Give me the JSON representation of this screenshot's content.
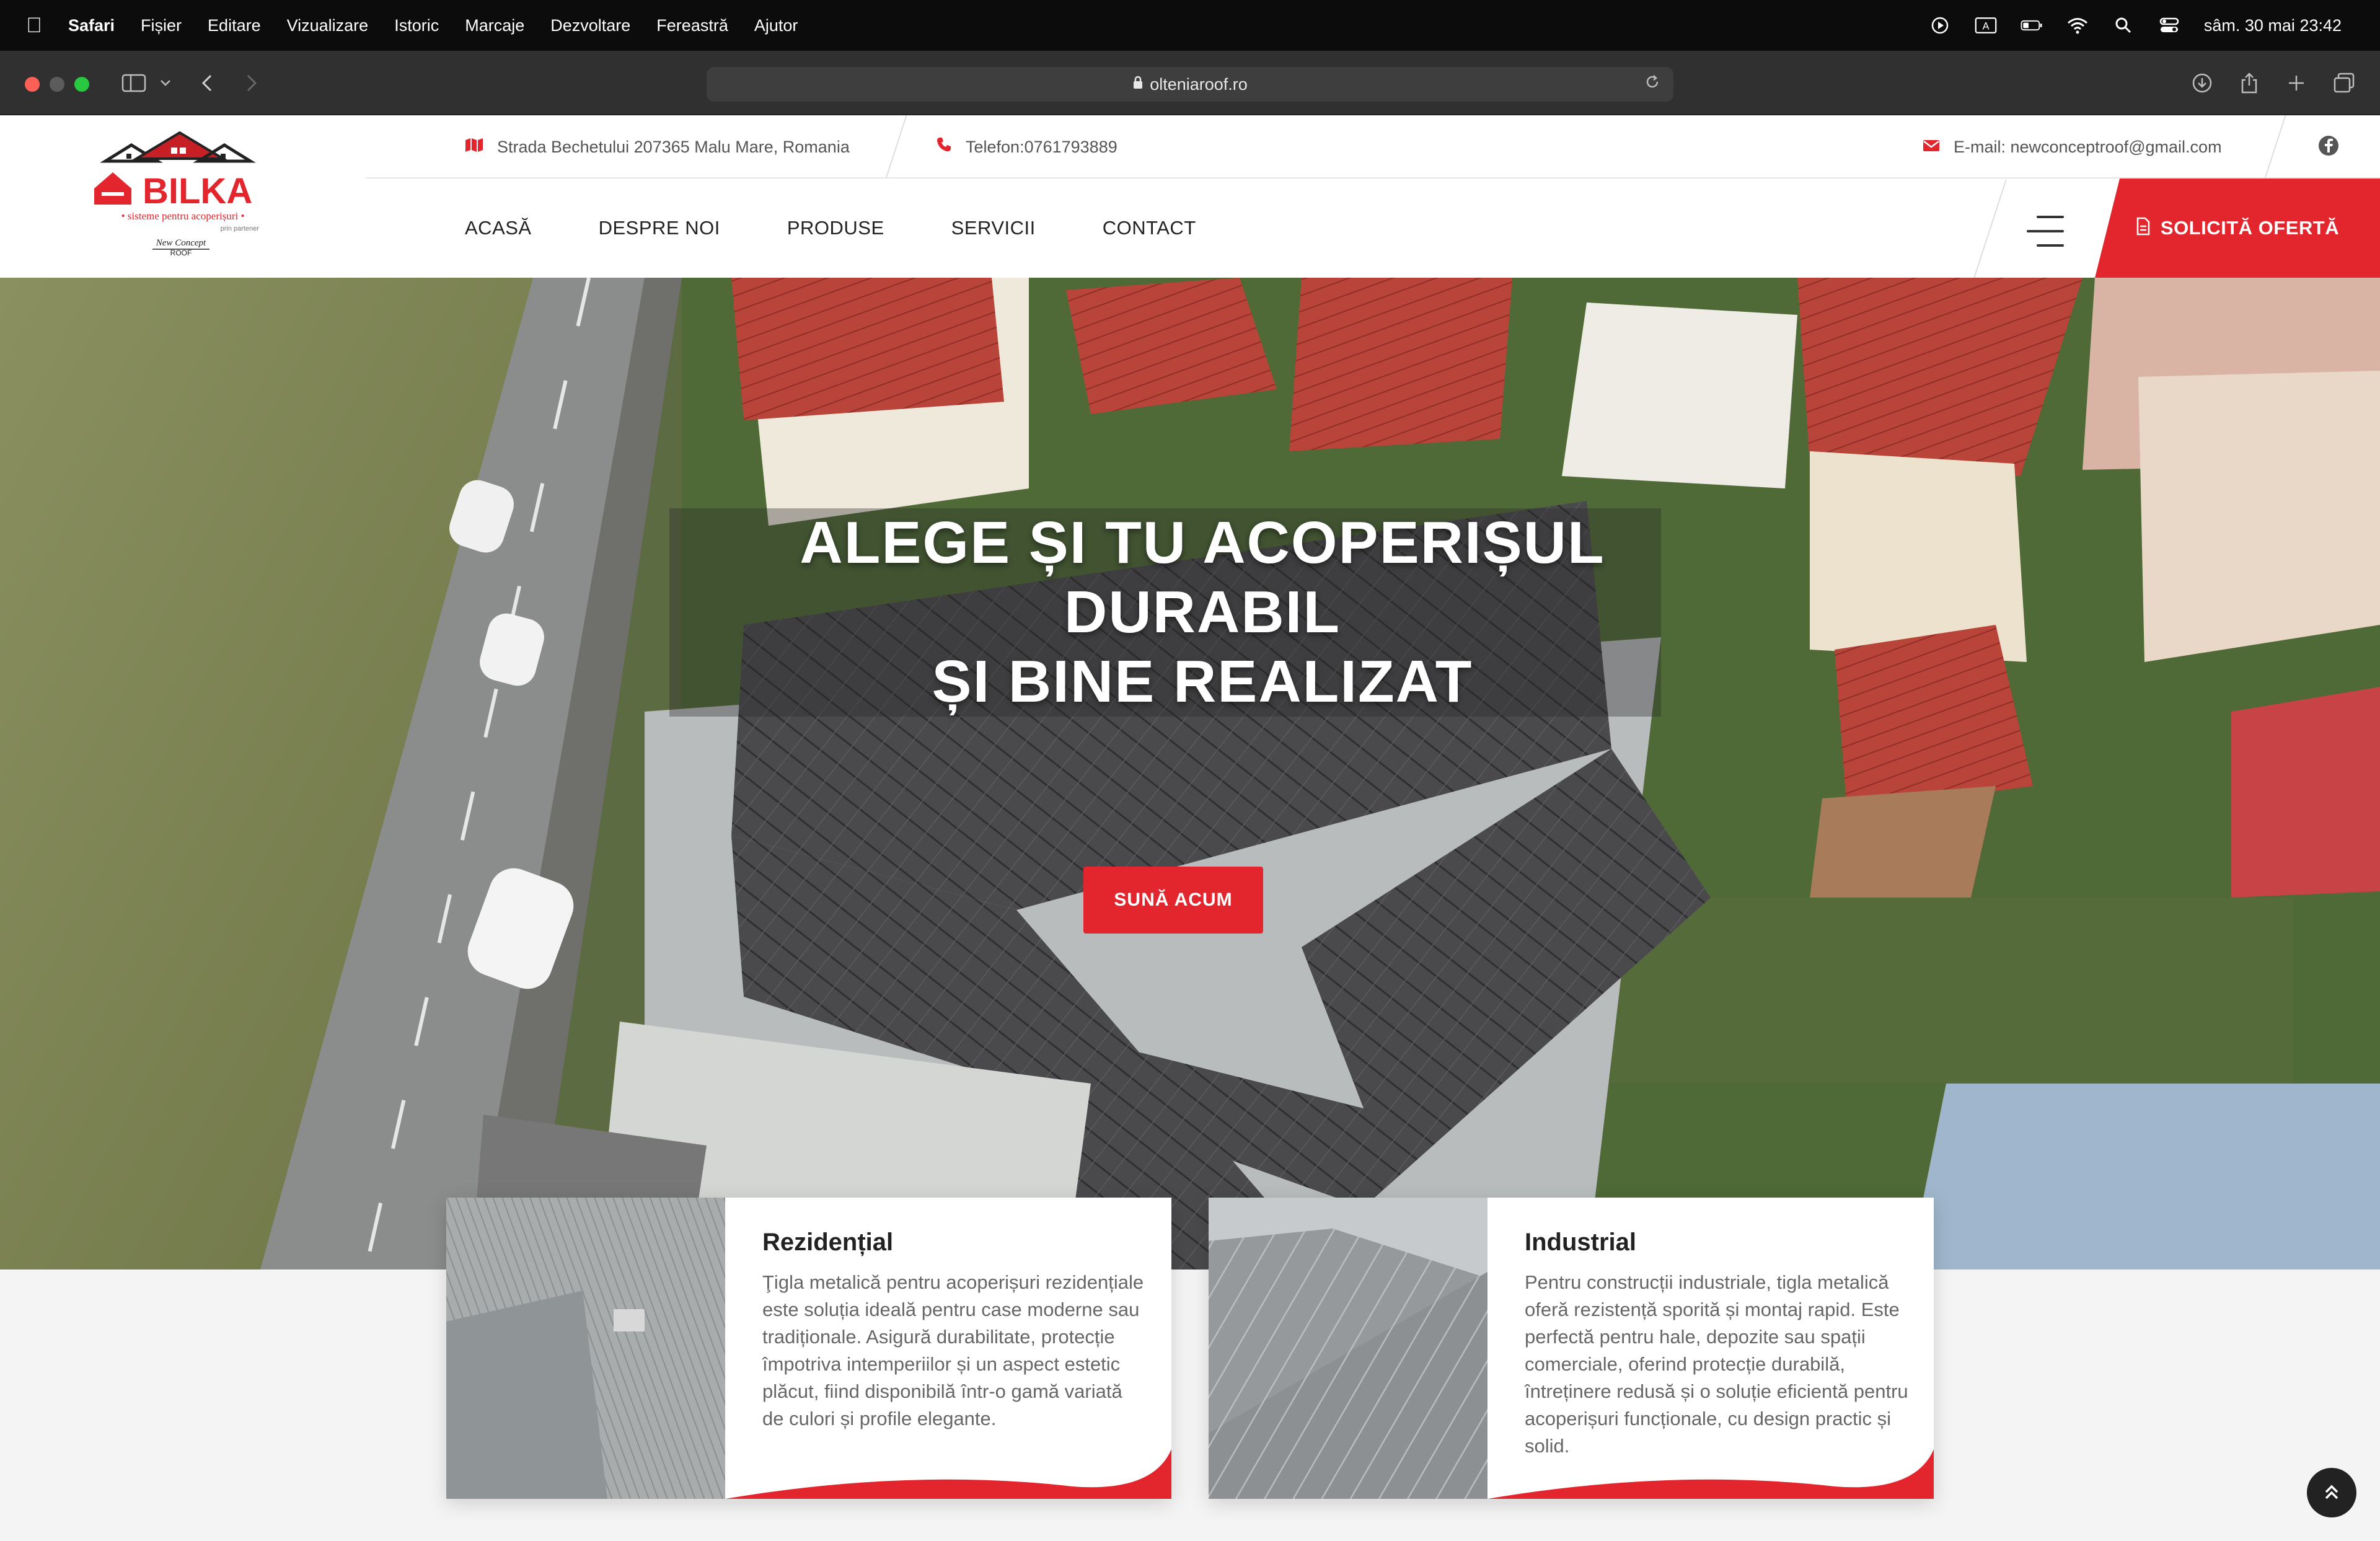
{
  "menubar": {
    "app": "Safari",
    "items": [
      "Fișier",
      "Editare",
      "Vizualizare",
      "Istoric",
      "Marcaje",
      "Dezvoltare",
      "Fereastră",
      "Ajutor"
    ],
    "keyboard_indicator": "A",
    "clock": "sâm. 30 mai  23:42"
  },
  "browser": {
    "url": "olteniaroof.ro"
  },
  "logo": {
    "brand": "BILKA",
    "tagline": "• sisteme pentru acoperișuri •",
    "partner_note": "prin partener",
    "partner_name": "New Concept ROOF"
  },
  "topinfo": {
    "address": "Strada Bechetului 207365 Malu Mare, Romania",
    "phone": "Telefon:0761793889",
    "email": "E-mail:  newconceptroof@gmail.com"
  },
  "nav": {
    "items": [
      "ACASĂ",
      "DESPRE NOI",
      "PRODUSE",
      "SERVICII",
      "CONTACT"
    ],
    "cta": "SOLICITĂ OFERTĂ"
  },
  "hero": {
    "line1": "ALEGE ȘI TU ACOPERIȘUL",
    "line2": "DURABIL",
    "line3": "ȘI BINE REALIZAT",
    "button": "SUNĂ ACUM"
  },
  "cards": [
    {
      "title": "Rezidențial",
      "text": "Ţigla metalică pentru acoperișuri rezidențiale este soluția ideală pentru case moderne sau tradiționale. Asigură durabilitate, protecție împotriva intemperiilor și un aspect estetic plăcut, fiind disponibilă într-o gamă variată de culori și profile elegante."
    },
    {
      "title": "Industrial",
      "text": "Pentru construcții industriale, tigla metalică oferă rezistență sporită și montaj rapid. Este perfectă pentru hale, depozite sau spații comerciale, oferind protecție durabilă, întreținere redusă și o soluție eficientă pentru acoperișuri funcționale, cu design practic și solid."
    }
  ],
  "colors": {
    "brand_red": "#e3262d",
    "menubar": "#0c0c0c",
    "toolbar": "#303030"
  }
}
